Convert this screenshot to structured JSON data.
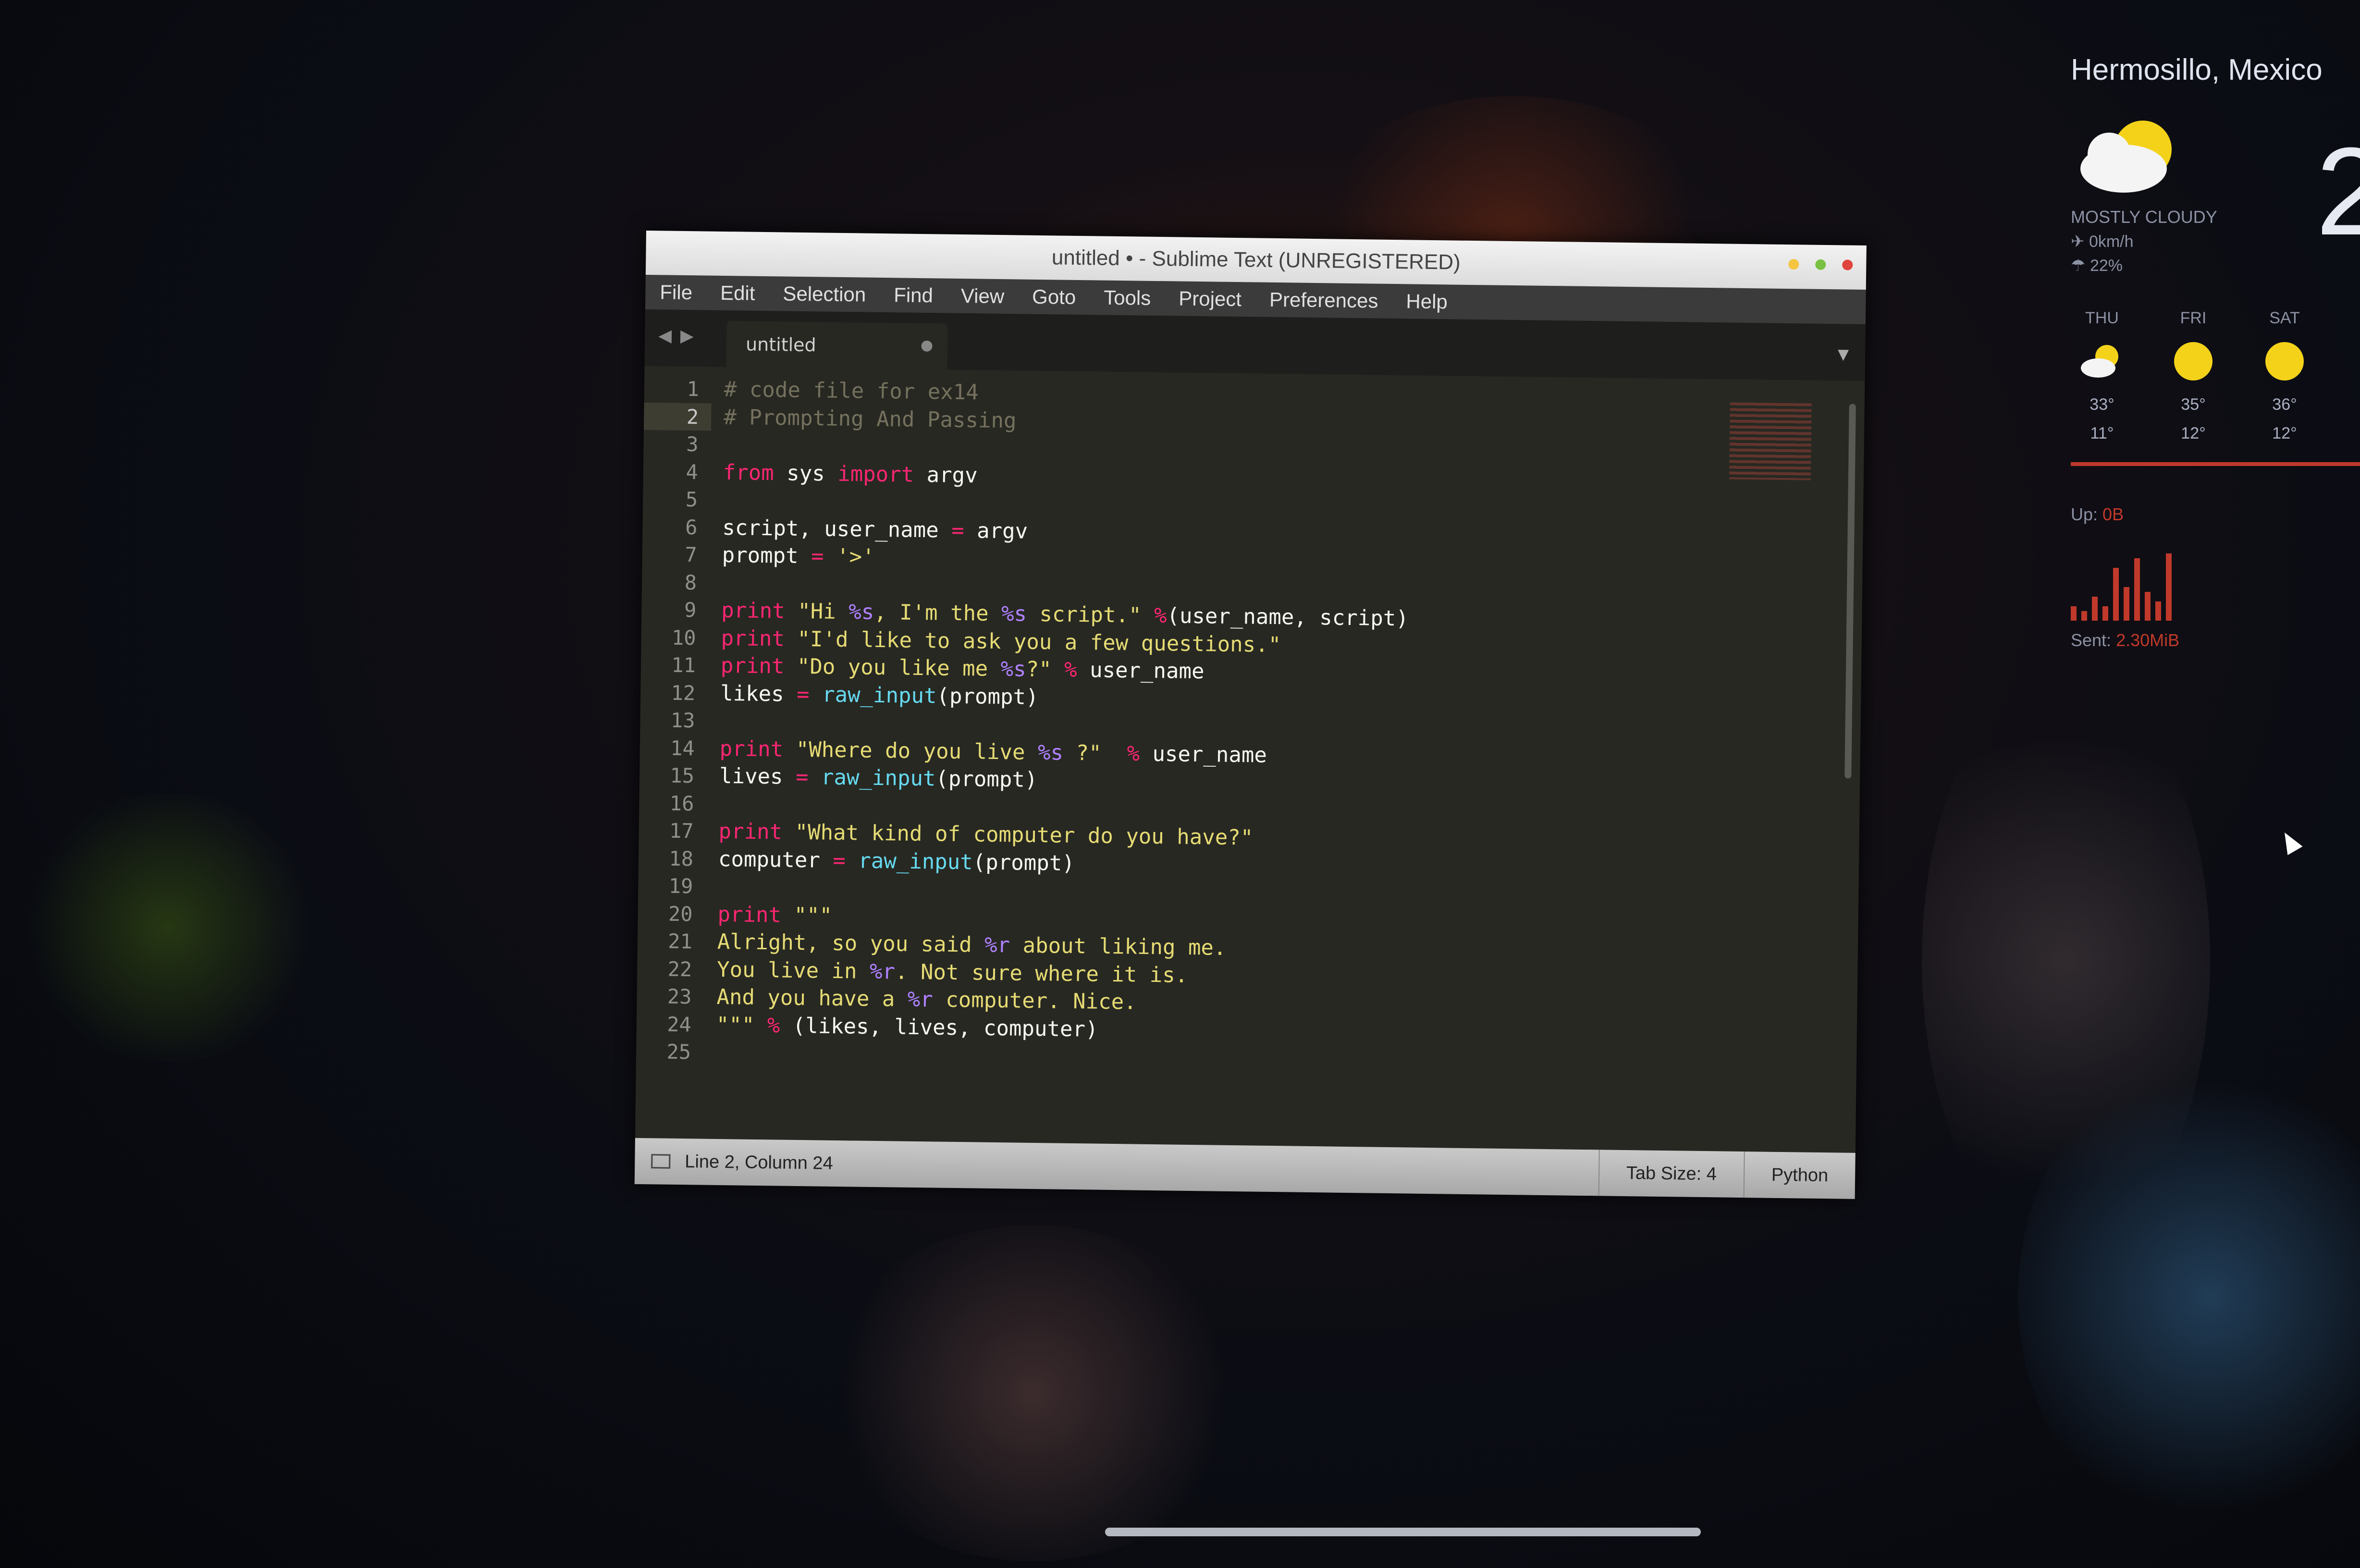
{
  "window": {
    "title": "untitled • - Sublime Text (UNREGISTERED)",
    "menu": [
      "File",
      "Edit",
      "Selection",
      "Find",
      "View",
      "Goto",
      "Tools",
      "Project",
      "Preferences",
      "Help"
    ],
    "tab": {
      "label": "untitled",
      "close_symbol": "●"
    },
    "code_lines": [
      [
        {
          "t": "# code file for ex14",
          "c": "c"
        }
      ],
      [
        {
          "t": "# Prompting And Passing",
          "c": "c"
        }
      ],
      [],
      [
        {
          "t": "from",
          "c": "k"
        },
        {
          "t": " sys "
        },
        {
          "t": "import",
          "c": "k"
        },
        {
          "t": " argv"
        }
      ],
      [],
      [
        {
          "t": "script, user_name "
        },
        {
          "t": "=",
          "c": "k"
        },
        {
          "t": " argv"
        }
      ],
      [
        {
          "t": "prompt "
        },
        {
          "t": "=",
          "c": "k"
        },
        {
          "t": " "
        },
        {
          "t": "'>'",
          "c": "s"
        }
      ],
      [],
      [
        {
          "t": "print",
          "c": "k"
        },
        {
          "t": " "
        },
        {
          "t": "\"Hi ",
          "c": "s"
        },
        {
          "t": "%s",
          "c": "v"
        },
        {
          "t": ", I'm the ",
          "c": "s"
        },
        {
          "t": "%s",
          "c": "v"
        },
        {
          "t": " script.\"",
          "c": "s"
        },
        {
          "t": " "
        },
        {
          "t": "%",
          "c": "k"
        },
        {
          "t": "(user_name, script)"
        }
      ],
      [
        {
          "t": "print",
          "c": "k"
        },
        {
          "t": " "
        },
        {
          "t": "\"I'd like to ask you a few questions.\"",
          "c": "s"
        }
      ],
      [
        {
          "t": "print",
          "c": "k"
        },
        {
          "t": " "
        },
        {
          "t": "\"Do you like me ",
          "c": "s"
        },
        {
          "t": "%s",
          "c": "v"
        },
        {
          "t": "?\"",
          "c": "s"
        },
        {
          "t": " "
        },
        {
          "t": "%",
          "c": "k"
        },
        {
          "t": " user_name"
        }
      ],
      [
        {
          "t": "likes "
        },
        {
          "t": "=",
          "c": "k"
        },
        {
          "t": " "
        },
        {
          "t": "raw_input",
          "c": "f"
        },
        {
          "t": "(prompt)"
        }
      ],
      [],
      [
        {
          "t": "print",
          "c": "k"
        },
        {
          "t": " "
        },
        {
          "t": "\"Where do you live ",
          "c": "s"
        },
        {
          "t": "%s",
          "c": "v"
        },
        {
          "t": " ?\"",
          "c": "s"
        },
        {
          "t": "  "
        },
        {
          "t": "%",
          "c": "k"
        },
        {
          "t": " user_name"
        }
      ],
      [
        {
          "t": "lives "
        },
        {
          "t": "=",
          "c": "k"
        },
        {
          "t": " "
        },
        {
          "t": "raw_input",
          "c": "f"
        },
        {
          "t": "(prompt)"
        }
      ],
      [],
      [
        {
          "t": "print",
          "c": "k"
        },
        {
          "t": " "
        },
        {
          "t": "\"What kind of computer do you have?\"",
          "c": "s"
        }
      ],
      [
        {
          "t": "computer "
        },
        {
          "t": "=",
          "c": "k"
        },
        {
          "t": " "
        },
        {
          "t": "raw_input",
          "c": "f"
        },
        {
          "t": "(prompt)"
        }
      ],
      [],
      [
        {
          "t": "print",
          "c": "k"
        },
        {
          "t": " "
        },
        {
          "t": "\"\"\"",
          "c": "s"
        }
      ],
      [
        {
          "t": "Alright, so you said ",
          "c": "s"
        },
        {
          "t": "%r",
          "c": "v"
        },
        {
          "t": " about liking me.",
          "c": "s"
        }
      ],
      [
        {
          "t": "You live in ",
          "c": "s"
        },
        {
          "t": "%r",
          "c": "v"
        },
        {
          "t": ". Not sure where it is.",
          "c": "s"
        }
      ],
      [
        {
          "t": "And you have a ",
          "c": "s"
        },
        {
          "t": "%r",
          "c": "v"
        },
        {
          "t": " computer. Nice.",
          "c": "s"
        }
      ],
      [
        {
          "t": "\"\"\"",
          "c": "s"
        },
        {
          "t": " "
        },
        {
          "t": "%",
          "c": "k"
        },
        {
          "t": " (likes, lives, computer)"
        }
      ],
      []
    ],
    "active_line": 2,
    "status": {
      "position": "Line 2, Column 24",
      "tab_size": "Tab Size: 4",
      "syntax": "Python"
    }
  },
  "weather": {
    "city": "Hermosillo, Mexico",
    "current_temp": "2",
    "condition": "MOSTLY CLOUDY",
    "wind": "0km/h",
    "humidity": "22%",
    "days": [
      {
        "name": "THU",
        "icon": "cloud-sun-icon",
        "high": "33°",
        "low": "11°"
      },
      {
        "name": "FRI",
        "icon": "sun-icon",
        "high": "35°",
        "low": "12°"
      },
      {
        "name": "SAT",
        "icon": "sun-icon",
        "high": "36°",
        "low": "12°"
      }
    ],
    "net": {
      "up_label": "Up:",
      "up_value": "0B",
      "sent_label": "Sent:",
      "sent_value": "2.30MiB"
    }
  },
  "colors": {
    "accent_red": "#c0392b",
    "keyword": "#f92672",
    "string": "#e6db74",
    "comment": "#75715e",
    "function": "#66d9ef",
    "format": "#ae81ff"
  }
}
